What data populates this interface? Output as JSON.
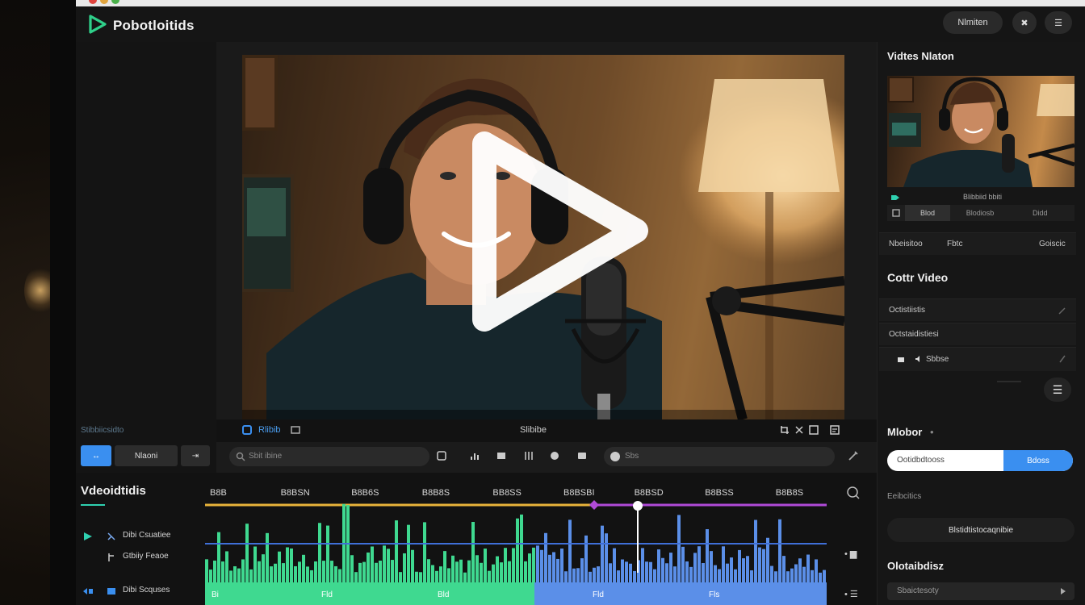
{
  "app": {
    "title": "Pobotloitids",
    "header_buttons": {
      "primary": "Nlmiten",
      "icon1": "✖",
      "icon2": "☰"
    }
  },
  "left_panel": {
    "label": "Stibbiicsidto",
    "tools": {
      "active": "↔",
      "middle": "Nlaoni",
      "right": "⇥"
    }
  },
  "preview_bar": {
    "left_label": "Rlibib",
    "center_label": "Slibibe"
  },
  "toolbar": {
    "search_placeholder": "Sbit ibine",
    "field_placeholder": "Sbs"
  },
  "timeline": {
    "title": "Vdeoidtidis",
    "ruler_labels": [
      "B8B",
      "B8BSN",
      "B8B6S",
      "B8B8S",
      "BB8SS",
      "B8BSBI",
      "B8BSD",
      "B8BSS",
      "B8B8S"
    ],
    "tracks": [
      {
        "label": "Dibi Csuatiee"
      },
      {
        "label": "Gtbiiy Feaoe"
      },
      {
        "label": "Dibi Scquses"
      }
    ],
    "playhead_position": 0.69,
    "clip_labels": [
      "Bi",
      "Fld",
      "Bld",
      "Fld",
      "Fls"
    ]
  },
  "right_panel": {
    "section1_title": "Vidtes Nlaton",
    "thumb_caption": "Blibbiid bbiti",
    "thumb_tabs": [
      "Blod",
      "Blodiosb",
      "Didd"
    ],
    "row1": {
      "left": "Nbeisitoo",
      "mid": "Fbtc",
      "right": "Goiscic"
    },
    "section2_title": "Cottr Video",
    "rows": [
      "Octistiistis",
      "Octstaidistiesi",
      "Sbbse"
    ],
    "section3_title": "Mlobor",
    "pill_input": {
      "left": "Ootidbdtooss",
      "button": "Bdoss"
    },
    "sub_label": "Eeibcitics",
    "dark_pill": "Blstidtistocaqnibie",
    "section4_title": "Olotaibdisz",
    "dark_input": "Sbaictesoty"
  },
  "colors": {
    "accent_teal": "#2fd0b0",
    "accent_blue": "#3a8ff0",
    "waveform_green": "#3fd990",
    "waveform_blue": "#5b8fe8",
    "track_line_yellow": "#e8b33a",
    "track_line_purple": "#b04ad8"
  }
}
